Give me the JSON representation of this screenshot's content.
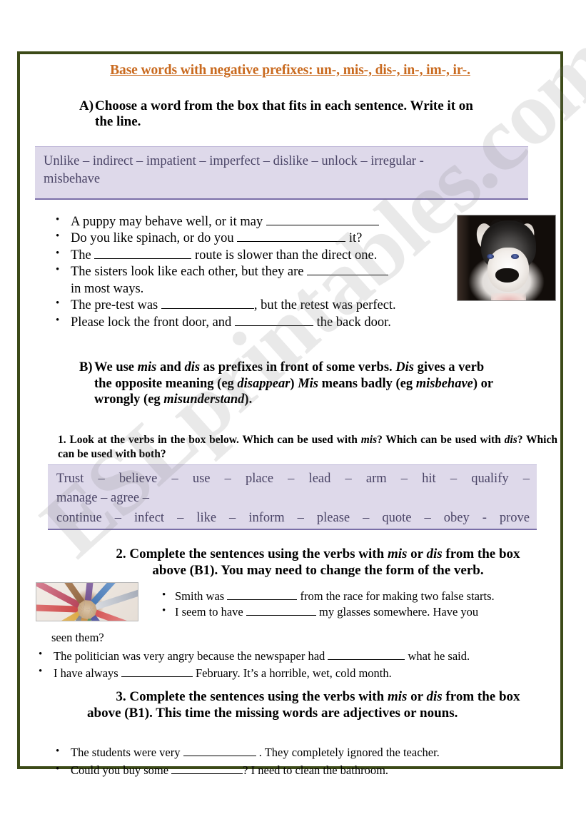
{
  "worksheet": {
    "title": "Base words with negative prefixes: un-, mis-, dis-, in-, im-, ir-.",
    "watermark": "ESLprintables.com",
    "accent_title_color": "#c96a1f",
    "border_color": "#3c4a18",
    "wordbox_bg_color": "#ded9ea",
    "wordbox_text_color": "#4a4466"
  },
  "task_a": {
    "label": "A)",
    "text": "Choose a word from the box that fits in each sentence. Write it on",
    "text_line2": "the line.",
    "wordbank": {
      "line1": "Unlike  –  indirect  –  impatient  –  imperfect  –  dislike  –  unlock  –  irregular  -",
      "line2": "misbehave",
      "words": [
        "Unlike",
        "indirect",
        "impatient",
        "imperfect",
        "dislike",
        "unlock",
        "irregular",
        "misbehave"
      ]
    },
    "items": [
      {
        "pre": "A puppy may behave well, or it may ",
        "blank": 158,
        "post": ""
      },
      {
        "pre": "Do you like spinach, or do you ",
        "blank": 152,
        "post": " it?"
      },
      {
        "pre": "The ",
        "blank": 136,
        "post": " route is slower than the direct one."
      },
      {
        "pre": "The sisters look like each other, but they are ",
        "blank": 114,
        "post": ""
      },
      {
        "pre": "in most ways.",
        "blank": 0,
        "post": ""
      },
      {
        "pre": "The pre-test was ",
        "blank": 130,
        "post": ", but the retest was perfect."
      },
      {
        "pre": "Please lock the front door, and ",
        "blank": 110,
        "post": " the back door."
      }
    ]
  },
  "task_b": {
    "label": "B)",
    "line1_a": "We use ",
    "line1_i1": "mis",
    "line1_b": " and ",
    "line1_i2": "dis",
    "line1_c": " as prefixes in front of some verbs. ",
    "line1_i3": "Dis",
    "line1_d": " gives a verb",
    "line2_a": "the opposite meaning (eg ",
    "line2_i1": "disappear",
    "line2_b": ") ",
    "line2_i2": "Mis",
    "line2_c": " means badly (eg ",
    "line2_i3": "misbehave",
    "line2_d": ") or",
    "line3_a": "wrongly (eg ",
    "line3_i1": "misunderstand",
    "line3_b": ")."
  },
  "task_b1": {
    "a": "1. Look at the verbs in the box below. Which can be used with ",
    "i1": "mis",
    "b": "? Which can be used with ",
    "i2": "dis",
    "c": "? Which can be used with both?",
    "wordbank": {
      "line1": "Trust  –  believe  –  use  –  place  –  lead  –  arm  –  hit  –  qualify  –",
      "line2": "manage  –  agree  –",
      "line3": "continue  –  infect  –  like  –  inform  –  please  –  quote  –  obey  -  prove",
      "words": [
        "Trust",
        "believe",
        "use",
        "place",
        "lead",
        "arm",
        "hit",
        "qualify",
        "manage",
        "agree",
        "continue",
        "infect",
        "like",
        "inform",
        "please",
        "quote",
        "obey",
        "prove"
      ]
    }
  },
  "task_b2": {
    "head_a": "2. Complete the sentences using the verbs with ",
    "head_i1": "mis",
    "head_b": " or ",
    "head_i2": "dis",
    "head_c": " from the box",
    "head_line2": "above (B1). You may need to change the form of the verb.",
    "items": [
      {
        "pre": "Smith was ",
        "blank": 98,
        "post": " from the race for making two false starts."
      },
      {
        "pre": "I  seem  to  have ",
        "blank": 98,
        "post": "  my  glasses  somewhere.  Have  you"
      }
    ],
    "continuation": "seen them?",
    "items2": [
      {
        "pre": "The politician was very angry because the newspaper had ",
        "blank": 108,
        "post": " what he said."
      },
      {
        "pre": "I have always ",
        "blank": 100,
        "post": " February. It’s a horrible, wet, cold month."
      }
    ]
  },
  "task_b3": {
    "head_a": "3. Complete the sentences using the verbs with ",
    "head_i1": "mis",
    "head_b": " or ",
    "head_i2": "dis",
    "head_c": " from the box",
    "head_line2": "above (B1). This time the missing words are adjectives or nouns.",
    "items": [
      {
        "pre": "The students were very ",
        "blank": 102,
        "post": " . They completely ignored the teacher."
      },
      {
        "pre": "Could you buy some ",
        "blank": 100,
        "post": "? I need to clean the bathroom."
      }
    ]
  },
  "images": {
    "puppy": "husky-puppy-photo",
    "pencils": "colored-pencils-photo"
  }
}
